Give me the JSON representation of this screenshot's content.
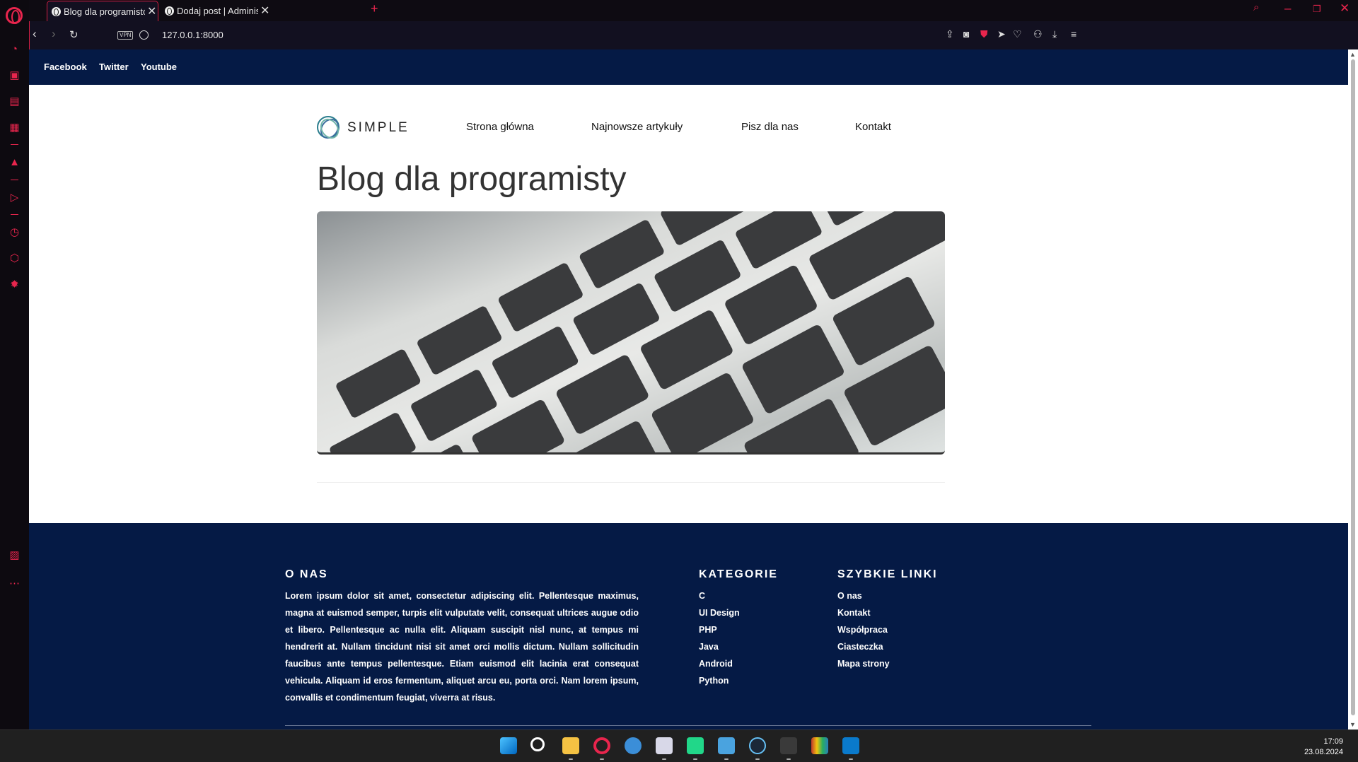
{
  "browser": {
    "tabs": [
      {
        "title": "Blog dla programistów",
        "active": true
      },
      {
        "title": "Dodaj post | Administracja",
        "active": false
      }
    ],
    "url": "127.0.0.1:8000",
    "vpn_label": "VPN",
    "accent_color": "#e8254d"
  },
  "page": {
    "social_links": [
      "Facebook",
      "Twitter",
      "Youtube"
    ],
    "brand": "SIMPLE",
    "nav": [
      "Strona główna",
      "Najnowsze artykuły",
      "Pisz dla nas",
      "Kontakt"
    ],
    "heading": "Blog dla programisty",
    "footer": {
      "about_title": "O NAS",
      "about_text": "Lorem ipsum dolor sit amet, consectetur adipiscing elit. Pellentesque maximus, magna at euismod semper, turpis elit vulputate velit, consequat ultrices augue odio et libero. Pellentesque ac nulla elit. Aliquam suscipit nisl nunc, at tempus mi hendrerit at. Nullam tincidunt nisi sit amet orci mollis dictum. Nullam sollicitudin faucibus ante tempus pellentesque. Etiam euismod elit lacinia erat consequat vehicula. Aliquam id eros fermentum, aliquet arcu eu, porta orci. Nam lorem ipsum, convallis et condimentum feugiat, viverra at risus.",
      "categories_title": "KATEGORIE",
      "categories": [
        "C",
        "UI Design",
        "PHP",
        "Java",
        "Android",
        "Python"
      ],
      "quick_links_title": "SZYBKIE LINKI",
      "quick_links": [
        "O nas",
        "Kontakt",
        "Współpraca",
        "Ciasteczka",
        "Mapa strony"
      ]
    },
    "colors": {
      "navy": "#051a45"
    }
  },
  "taskbar": {
    "time": "17:09",
    "date": "23.08.2024"
  }
}
